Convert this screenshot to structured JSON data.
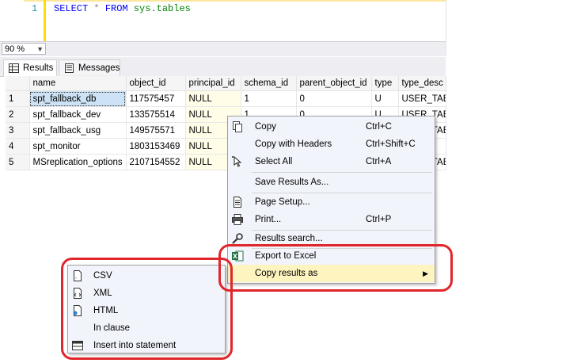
{
  "editor": {
    "line_number": "1",
    "kw_select": "SELECT",
    "star": "*",
    "kw_from": "FROM",
    "table": "sys.tables"
  },
  "zoom": {
    "value": "90 %"
  },
  "tabs": [
    {
      "label": "Results"
    },
    {
      "label": "Messages"
    }
  ],
  "grid": {
    "headers": [
      "",
      "name",
      "object_id",
      "principal_id",
      "schema_id",
      "parent_object_id",
      "type",
      "type_desc"
    ],
    "rows": [
      [
        "1",
        "spt_fallback_db",
        "117575457",
        "NULL",
        "1",
        "0",
        "U",
        "USER_TABLE"
      ],
      [
        "2",
        "spt_fallback_dev",
        "133575514",
        "NULL",
        "1",
        "0",
        "U",
        "USER_TABLE"
      ],
      [
        "3",
        "spt_fallback_usg",
        "149575571",
        "NULL",
        "",
        "",
        "",
        "USER_TABLE"
      ],
      [
        "4",
        "spt_monitor",
        "1803153469",
        "NULL",
        "",
        "",
        "",
        ""
      ],
      [
        "5",
        "MSreplication_options",
        "2107154552",
        "NULL",
        "",
        "",
        "",
        "USER_TABLE"
      ]
    ]
  },
  "context_menu": {
    "items": [
      {
        "label": "Copy",
        "shortcut": "Ctrl+C"
      },
      {
        "label": "Copy with Headers",
        "shortcut": "Ctrl+Shift+C"
      },
      {
        "label": "Select All",
        "shortcut": "Ctrl+A"
      },
      {
        "label": "Save Results As...",
        "shortcut": ""
      },
      {
        "label": "Page Setup...",
        "shortcut": ""
      },
      {
        "label": "Print...",
        "shortcut": "Ctrl+P"
      },
      {
        "label": "Results search...",
        "shortcut": ""
      },
      {
        "label": "Export to Excel",
        "shortcut": ""
      },
      {
        "label": "Copy results as",
        "shortcut": ""
      }
    ]
  },
  "submenu": {
    "items": [
      {
        "label": "CSV"
      },
      {
        "label": "XML"
      },
      {
        "label": "HTML"
      },
      {
        "label": "In clause"
      },
      {
        "label": "Insert into statement"
      }
    ]
  },
  "colors": {
    "highlight": "#fdf4bf",
    "annotation": "#e0262b",
    "menu_bg": "#f2f4fb"
  }
}
